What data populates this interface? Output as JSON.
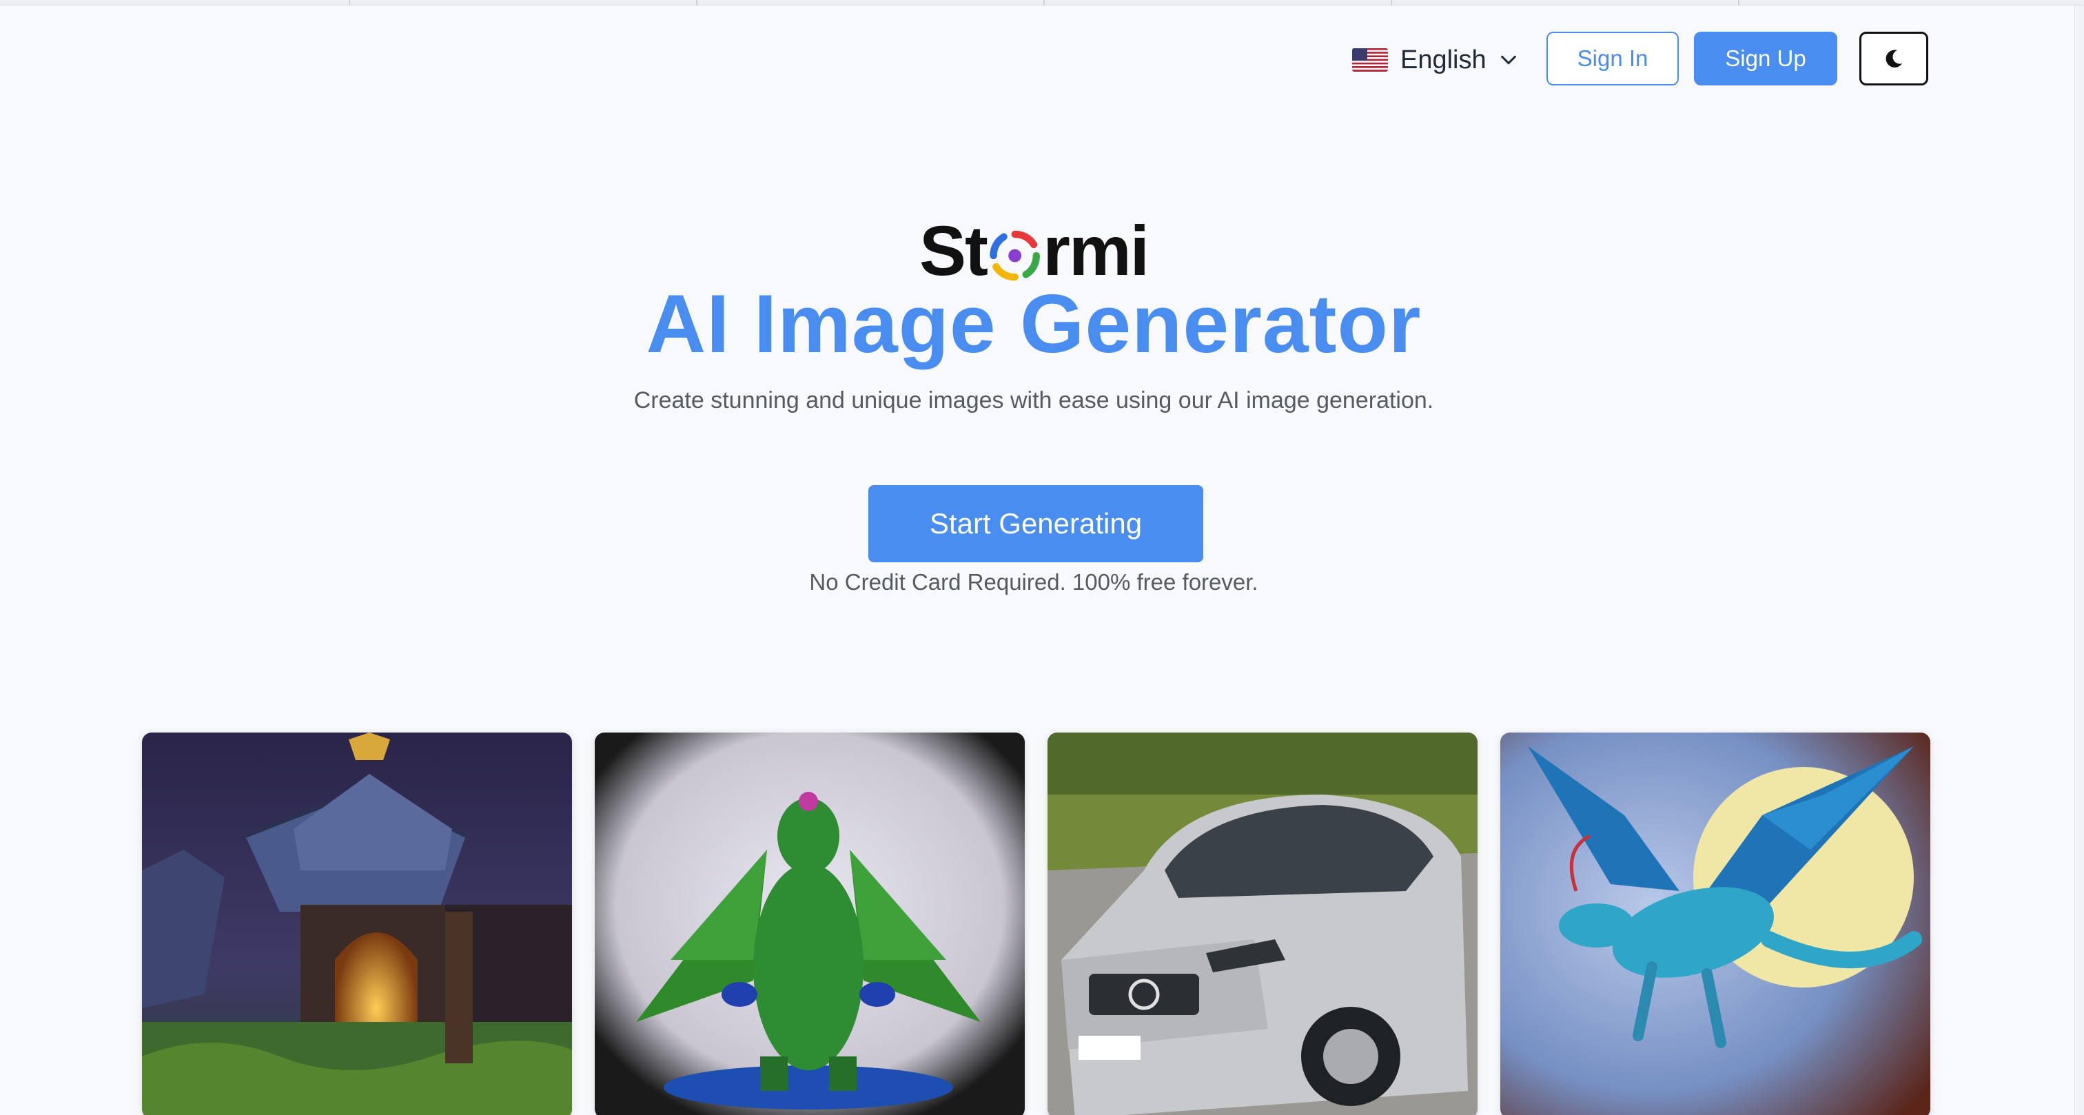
{
  "header": {
    "language": {
      "flag_icon": "us-flag-icon",
      "label": "English",
      "chevron_icon": "chevron-down-icon"
    },
    "sign_in_label": "Sign In",
    "sign_up_label": "Sign Up",
    "theme_toggle_icon": "moon-icon"
  },
  "hero": {
    "logo_text_left": "St",
    "logo_text_right": "rmi",
    "title": "AI Image Generator",
    "subtitle": "Create stunning and unique images with ease using our AI image generation.",
    "cta_label": "Start Generating",
    "cta_note": "No Credit Card Required. 100% free forever."
  },
  "gallery": {
    "items": [
      {
        "icon": "fantasy-house-image"
      },
      {
        "icon": "green-dragon-image"
      },
      {
        "icon": "silver-suv-image"
      },
      {
        "icon": "blue-dragon-moon-image"
      }
    ]
  },
  "colors": {
    "accent": "#4a8df0",
    "background": "#f8f9fc",
    "text_muted": "#555a63"
  }
}
